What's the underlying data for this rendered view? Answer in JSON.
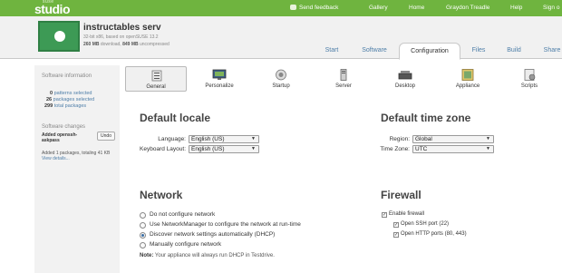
{
  "brand": {
    "top": "suse",
    "name": "studio"
  },
  "topnav": {
    "feedback": "Send feedback",
    "gallery": "Gallery",
    "home": "Home",
    "user": "Graydon Treadle",
    "help": "Help",
    "signout": "Sign o"
  },
  "appliance": {
    "title": "instructables serv",
    "line1": "32-bit x86, based on openSUSE 13.2",
    "line2_size1": "260 MB",
    "line2_text1": " download, ",
    "line2_size2": "849 MB",
    "line2_text2": " uncompressed"
  },
  "tabs": {
    "start": "Start",
    "software": "Software",
    "configuration": "Configuration",
    "files": "Files",
    "build": "Build",
    "share": "Share"
  },
  "sidebar": {
    "info_heading": "Software information",
    "patterns_count": "0",
    "patterns_label": " patterns selected",
    "packages_count": "26",
    "packages_label": " packages selected",
    "total_count": "299",
    "total_label": " total packages",
    "changes_heading": "Software changes",
    "added_label": "Added openssh-",
    "added_label2": "askpass",
    "undo": "Undo",
    "change_summary": "Added 1 packages, totaling 41 KB",
    "view_details": "View details..."
  },
  "config_tabs": [
    {
      "label": "General",
      "icon": "general-icon"
    },
    {
      "label": "Personalize",
      "icon": "personalize-icon"
    },
    {
      "label": "Startup",
      "icon": "startup-icon"
    },
    {
      "label": "Server",
      "icon": "server-icon"
    },
    {
      "label": "Desktop",
      "icon": "desktop-icon"
    },
    {
      "label": "Appliance",
      "icon": "appliance-icon"
    },
    {
      "label": "Scripts",
      "icon": "scripts-icon"
    }
  ],
  "locale": {
    "heading": "Default locale",
    "language_label": "Language:",
    "language_value": "English (US)",
    "keyboard_label": "Keyboard Layout:",
    "keyboard_value": "English (US)"
  },
  "timezone": {
    "heading": "Default time zone",
    "region_label": "Region:",
    "region_value": "Global",
    "zone_label": "Time Zone:",
    "zone_value": "UTC"
  },
  "network": {
    "heading": "Network",
    "options": [
      "Do not configure network",
      "Use NetworkManager to configure the network at run-time",
      "Discover network settings automatically (DHCP)",
      "Manually configure network"
    ],
    "selected_index": 2,
    "note_bold": "Note:",
    "note_text": " Your appliance will always run DHCP in Testdrive."
  },
  "firewall": {
    "heading": "Firewall",
    "enable": "Enable firewall",
    "ssh": "Open SSH port (22)",
    "http": "Open HTTP ports (80, 443)",
    "enable_checked": true,
    "ssh_checked": true,
    "http_checked": true
  },
  "colors": {
    "brand_green": "#6fb43f",
    "link_blue": "#4e7ea8"
  }
}
